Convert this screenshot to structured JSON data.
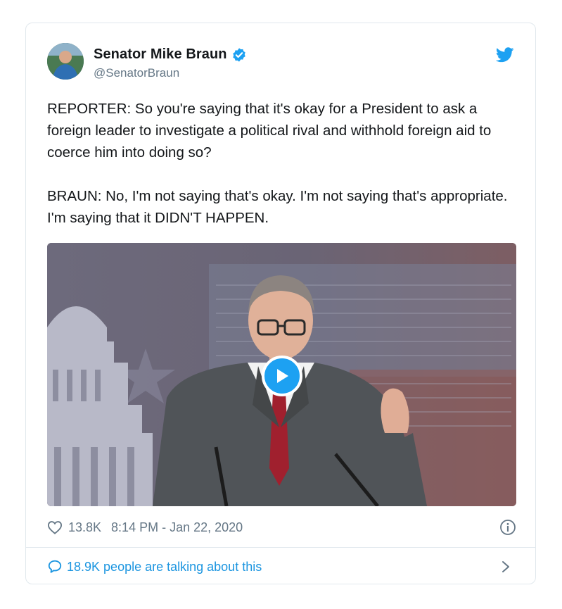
{
  "tweet": {
    "author_name": "Senator Mike Braun",
    "handle": "@SenatorBraun",
    "text": "REPORTER: So you're saying that it's okay for a President to ask a foreign leader to investigate a political rival and withhold foreign aid to coerce him into doing so?\n\nBRAUN: No, I'm not saying that's okay. I'm not saying that's appropriate. I'm saying that it DIDN'T HAPPEN.",
    "likes": "13.8K",
    "timestamp": "8:14 PM - Jan 22, 2020",
    "talking_count": "18.9K",
    "talking_text": "people are talking about this"
  },
  "icons": {
    "verified": "verified-badge-icon",
    "brand": "twitter-bird-icon",
    "like": "heart-icon",
    "info": "info-icon",
    "comment": "speech-bubble-icon",
    "chevron": "chevron-right-icon",
    "play": "play-icon"
  },
  "colors": {
    "accent": "#1da1f2",
    "link": "#1b95e0",
    "muted": "#657786",
    "border": "#e1e8ed"
  }
}
